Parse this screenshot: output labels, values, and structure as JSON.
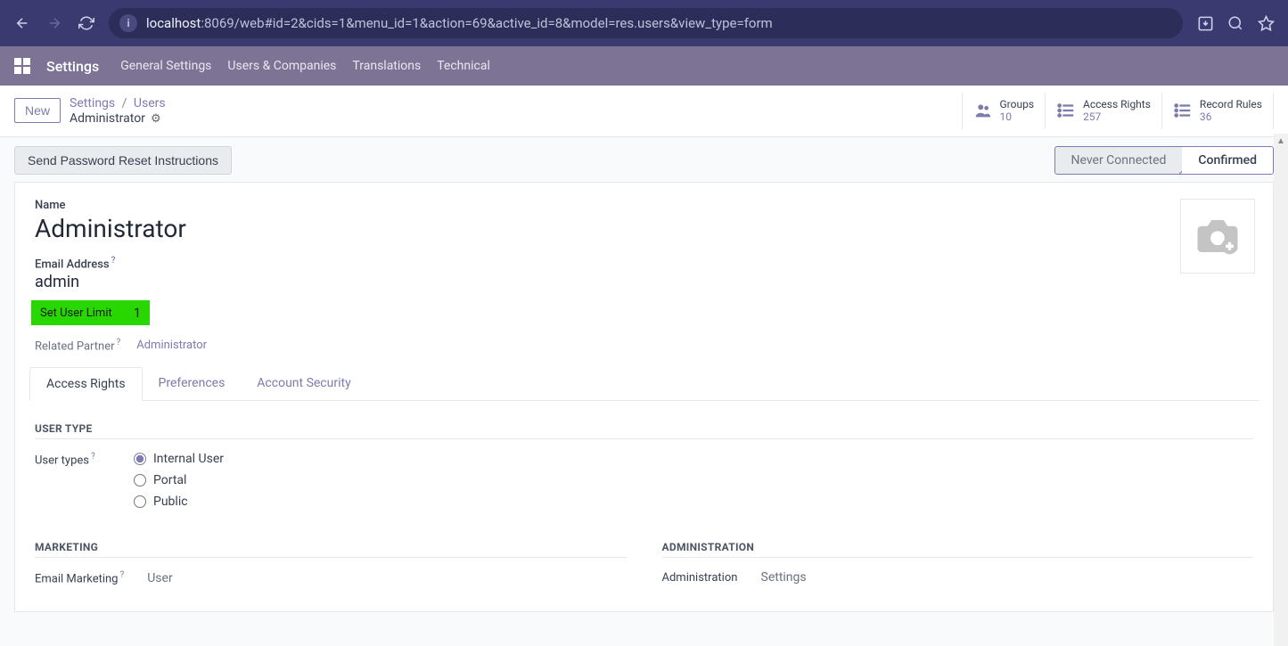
{
  "browser": {
    "url_host": "localhost",
    "url_rest": ":8069/web#id=2&cids=1&menu_id=1&action=69&active_id=8&model=res.users&view_type=form"
  },
  "topnav": {
    "current": "Settings",
    "items": [
      "General Settings",
      "Users & Companies",
      "Translations",
      "Technical"
    ]
  },
  "cp": {
    "new_btn": "New",
    "breadcrumb": {
      "root": "Settings",
      "mid": "Users",
      "current": "Administrator"
    },
    "stats": [
      {
        "label": "Groups",
        "val": "10"
      },
      {
        "label": "Access Rights",
        "val": "257"
      },
      {
        "label": "Record Rules",
        "val": "36"
      }
    ]
  },
  "statusbar": {
    "send_btn": "Send Password Reset Instructions",
    "s1": "Never Connected",
    "s2": "Confirmed"
  },
  "form": {
    "name_label": "Name",
    "name_value": "Administrator",
    "email_label": "Email Address",
    "email_value": "admin",
    "limit_label": "Set User Limit",
    "limit_value": "1",
    "partner_label": "Related Partner",
    "partner_value": "Administrator",
    "tabs": [
      "Access Rights",
      "Preferences",
      "Account Security"
    ],
    "sect_user_type": "USER TYPE",
    "user_types_label": "User types",
    "user_type_options": [
      "Internal User",
      "Portal",
      "Public"
    ],
    "sect_marketing": "MARKETING",
    "marketing_field_label": "Email Marketing",
    "marketing_field_value": "User",
    "sect_admin": "ADMINISTRATION",
    "admin_field_label": "Administration",
    "admin_field_value": "Settings"
  }
}
